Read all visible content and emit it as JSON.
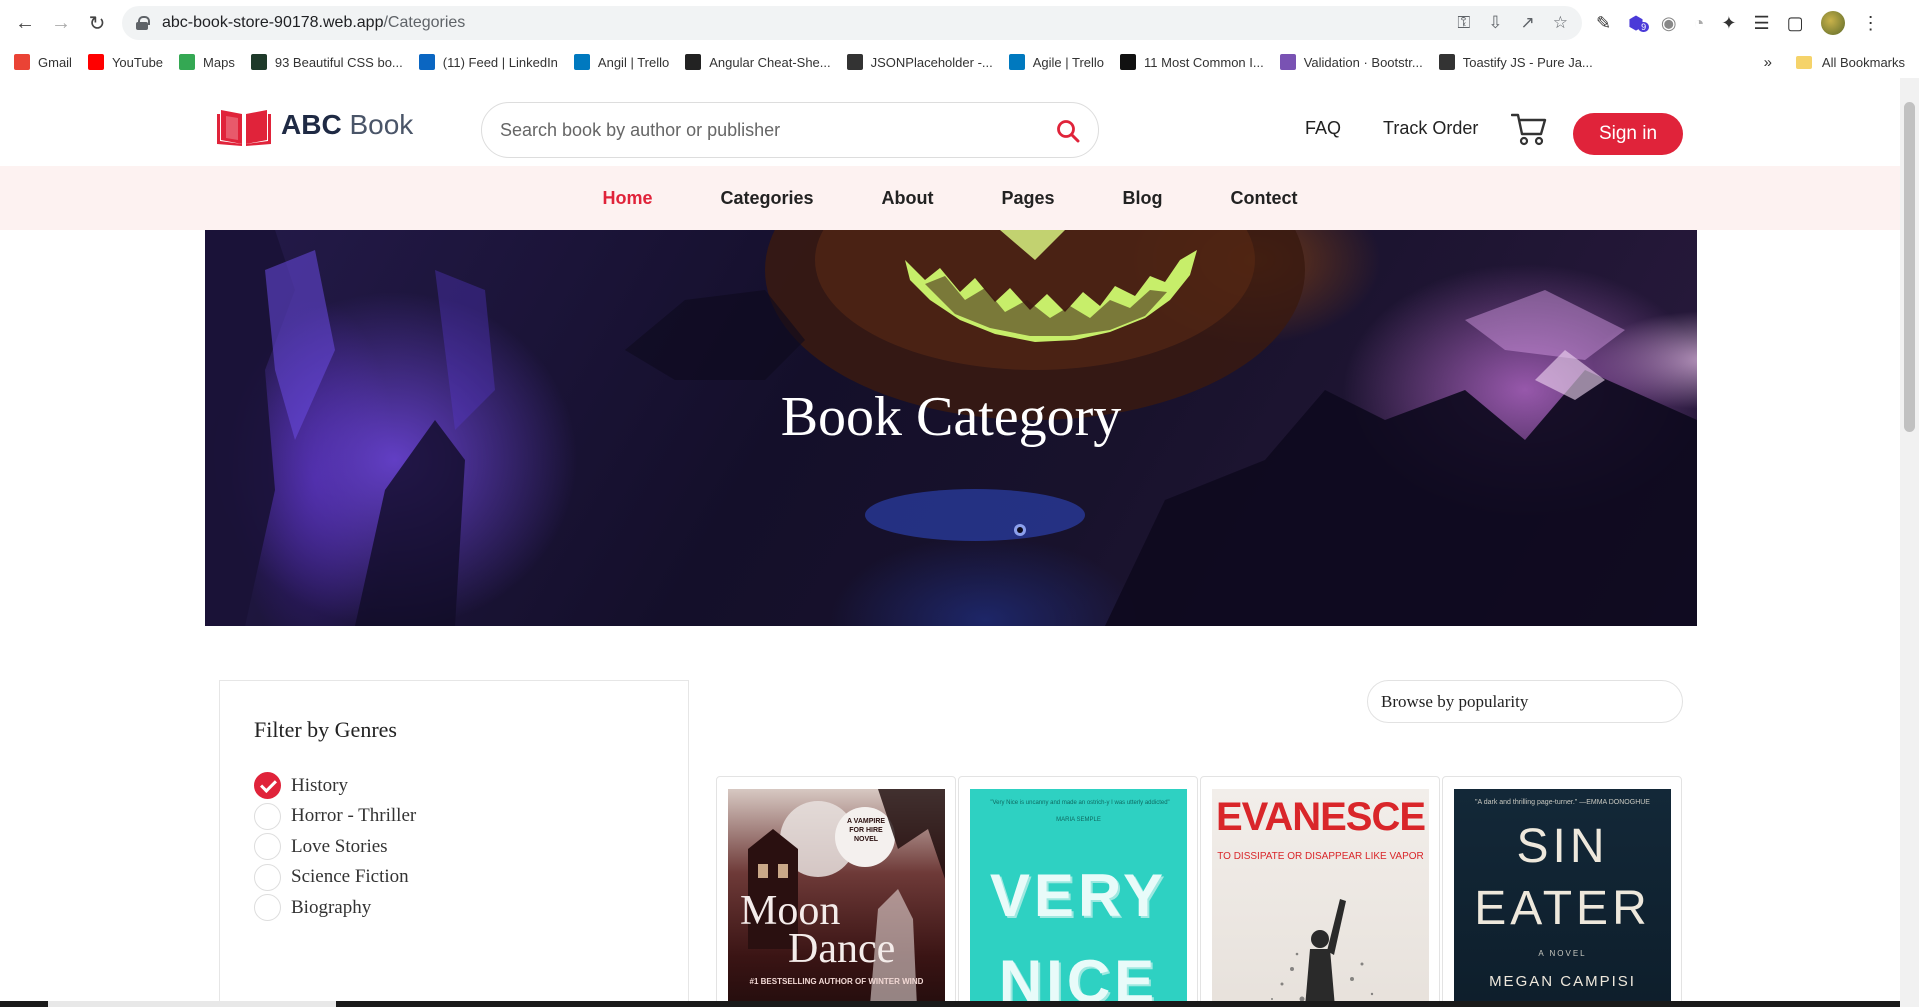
{
  "browser": {
    "url_host": "abc-book-store-90178.web.app",
    "url_path": "/Categories",
    "bookmarks": [
      {
        "label": "Gmail",
        "icon": "gmail-icon",
        "color": "#ea4335"
      },
      {
        "label": "YouTube",
        "icon": "youtube-icon",
        "color": "#ff0000"
      },
      {
        "label": "Maps",
        "icon": "maps-icon",
        "color": "#34a853"
      },
      {
        "label": "93 Beautiful CSS bo...",
        "icon": "css-icon",
        "color": "#1e3a2a"
      },
      {
        "label": "(11) Feed | LinkedIn",
        "icon": "linkedin-icon",
        "color": "#0a66c2"
      },
      {
        "label": "Angil | Trello",
        "icon": "trello-icon",
        "color": "#0079bf"
      },
      {
        "label": "Angular Cheat-She...",
        "icon": "angular-icon",
        "color": "#222222"
      },
      {
        "label": "JSONPlaceholder -...",
        "icon": "json-icon",
        "color": "#333333"
      },
      {
        "label": "Agile | Trello",
        "icon": "trello-icon",
        "color": "#0079bf"
      },
      {
        "label": "11 Most Common I...",
        "icon": "t-icon",
        "color": "#111111"
      },
      {
        "label": "Validation · Bootstr...",
        "icon": "bootstrap-icon",
        "color": "#7952b3"
      },
      {
        "label": "Toastify JS - Pure Ja...",
        "icon": "globe-icon",
        "color": "#333333"
      }
    ],
    "more_label": "»",
    "all_bookmarks": "All Bookmarks",
    "extension_badge": "9"
  },
  "header": {
    "logo_bold": "ABC",
    "logo_light": " Book",
    "search_placeholder": "Search book by author or publisher",
    "faq": "FAQ",
    "track_order": "Track Order",
    "sign_in": "Sign in",
    "accent_color": "#e0233a"
  },
  "menu": [
    "Home",
    "Categories",
    "About",
    "Pages",
    "Blog",
    "Contect"
  ],
  "menu_active": "Home",
  "hero": {
    "title": "Book Category"
  },
  "filter": {
    "title": "Filter by Genres",
    "genres": [
      {
        "label": "History",
        "checked": true
      },
      {
        "label": "Horror - Thriller",
        "checked": false
      },
      {
        "label": "Love Stories",
        "checked": false
      },
      {
        "label": "Science Fiction",
        "checked": false
      },
      {
        "label": "Biography",
        "checked": false
      }
    ]
  },
  "sort": {
    "value": "Browse by popularity"
  },
  "books": [
    {
      "title_line1": "Moon",
      "title_line2": "Dance",
      "badge": "A VAMPIRE FOR HIRE NOVEL",
      "footer": "#1 BESTSELLING AUTHOR OF WINTER WIND"
    },
    {
      "title_line1": "VERY",
      "title_line2": "NICE",
      "blurb": "\"Very Nice is uncanny and made an ostrich-y I was utterly addicted\"",
      "blurb_author": "MARIA SEMPLE"
    },
    {
      "title_line1": "EVANESCE",
      "subtitle": "TO DISSIPATE OR DISAPPEAR LIKE VAPOR"
    },
    {
      "title_line1": "SIN",
      "title_line2": "EATER",
      "blurb": "\"A dark and thrilling page-turner.\" —EMMA DONOGHUE",
      "label": "A NOVEL",
      "author": "MEGAN CAMPISI"
    }
  ]
}
